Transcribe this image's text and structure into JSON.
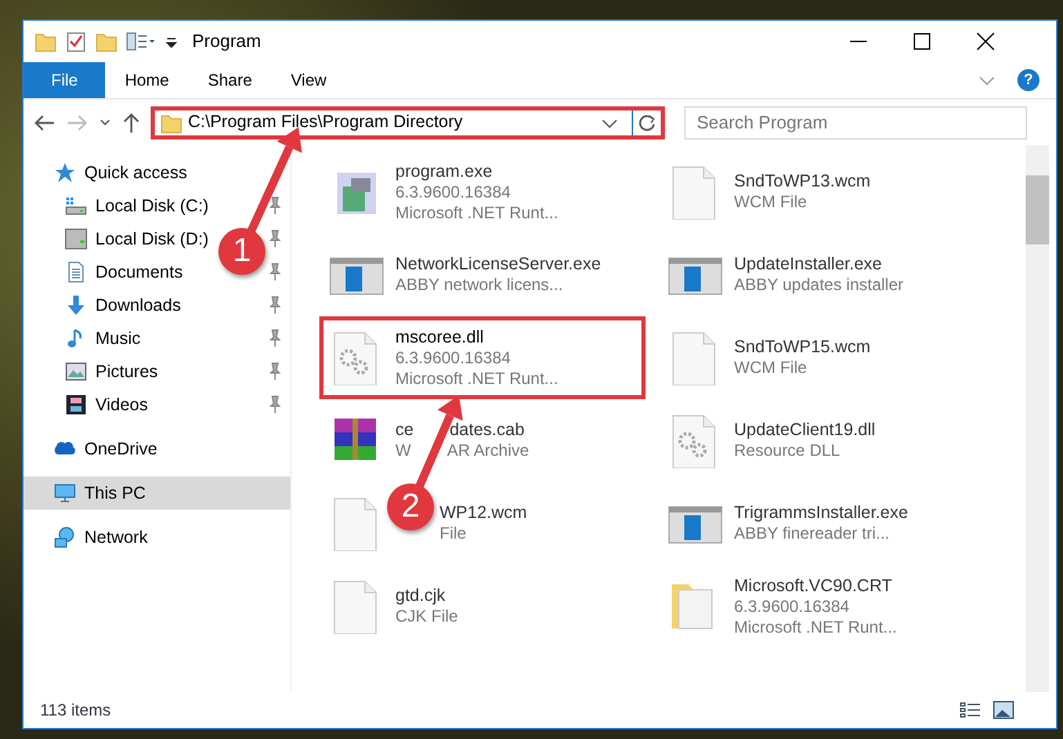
{
  "window": {
    "title": "Program"
  },
  "ribbon_tabs": [
    {
      "label": "File",
      "kind": "menu"
    },
    {
      "label": "Home",
      "kind": "tab"
    },
    {
      "label": "Share",
      "kind": "tab"
    },
    {
      "label": "View",
      "kind": "tab"
    }
  ],
  "address": {
    "path": "C:\\Program Files\\Program Directory",
    "highlighted": true
  },
  "search": {
    "placeholder": "Search Program"
  },
  "help_button": "?",
  "nav": [
    {
      "label": "Quick access",
      "selected": false,
      "children": [
        {
          "label": "Local Disk (C:)",
          "pinned": true
        },
        {
          "label": "Local Disk (D:)",
          "pinned": true
        },
        {
          "label": "Documents",
          "pinned": true
        },
        {
          "label": "Downloads",
          "pinned": true
        },
        {
          "label": "Music",
          "pinned": true
        },
        {
          "label": "Pictures",
          "pinned": true
        },
        {
          "label": "Videos",
          "pinned": true
        }
      ]
    },
    {
      "label": "OneDrive",
      "selected": false
    },
    {
      "label": "This PC",
      "selected": true
    },
    {
      "label": "Network",
      "selected": false
    }
  ],
  "files": [
    {
      "name": "program.exe",
      "details": [
        "6.3.9600.16384",
        "Microsoft .NET Runt..."
      ],
      "highlighted": false
    },
    {
      "name": "SndToWP13.wcm",
      "details": [
        "WCM File"
      ],
      "highlighted": false
    },
    {
      "name": "NetworkLicenseServer.exe",
      "details": [
        "ABBY network licens..."
      ],
      "highlighted": false
    },
    {
      "name": "UpdateInstaller.exe",
      "details": [
        "ABBY updates installer"
      ],
      "highlighted": false
    },
    {
      "name": "mscoree.dll",
      "details": [
        "6.3.9600.16384",
        "Microsoft .NET Runt..."
      ],
      "highlighted": true
    },
    {
      "name": "SndToWP15.wcm",
      "details": [
        "WCM File"
      ],
      "highlighted": false
    },
    {
      "name": [
        "ce",
        "dates.cab"
      ],
      "details": [
        [
          "W",
          "AR Archive"
        ]
      ],
      "highlighted": false
    },
    {
      "name": "UpdateClient19.dll",
      "details": [
        "Resource DLL"
      ],
      "highlighted": false
    },
    {
      "name": [
        "WP12.wcm"
      ],
      "details": [
        [
          "File"
        ]
      ],
      "covered_start": true,
      "highlighted": false
    },
    {
      "name": "TrigrammsInstaller.exe",
      "details": [
        "ABBY finereader tri..."
      ],
      "highlighted": false
    },
    {
      "name": "gtd.cjk",
      "details": [
        "CJK File"
      ],
      "highlighted": false
    },
    {
      "name": "Microsoft.VC90.CRT",
      "details": [
        "6.3.9600.16384",
        "Microsoft .NET Runt..."
      ],
      "highlighted": false
    }
  ],
  "callouts": [
    {
      "label": "1"
    },
    {
      "label": "2"
    }
  ],
  "status_bar": {
    "text": "113 items"
  }
}
